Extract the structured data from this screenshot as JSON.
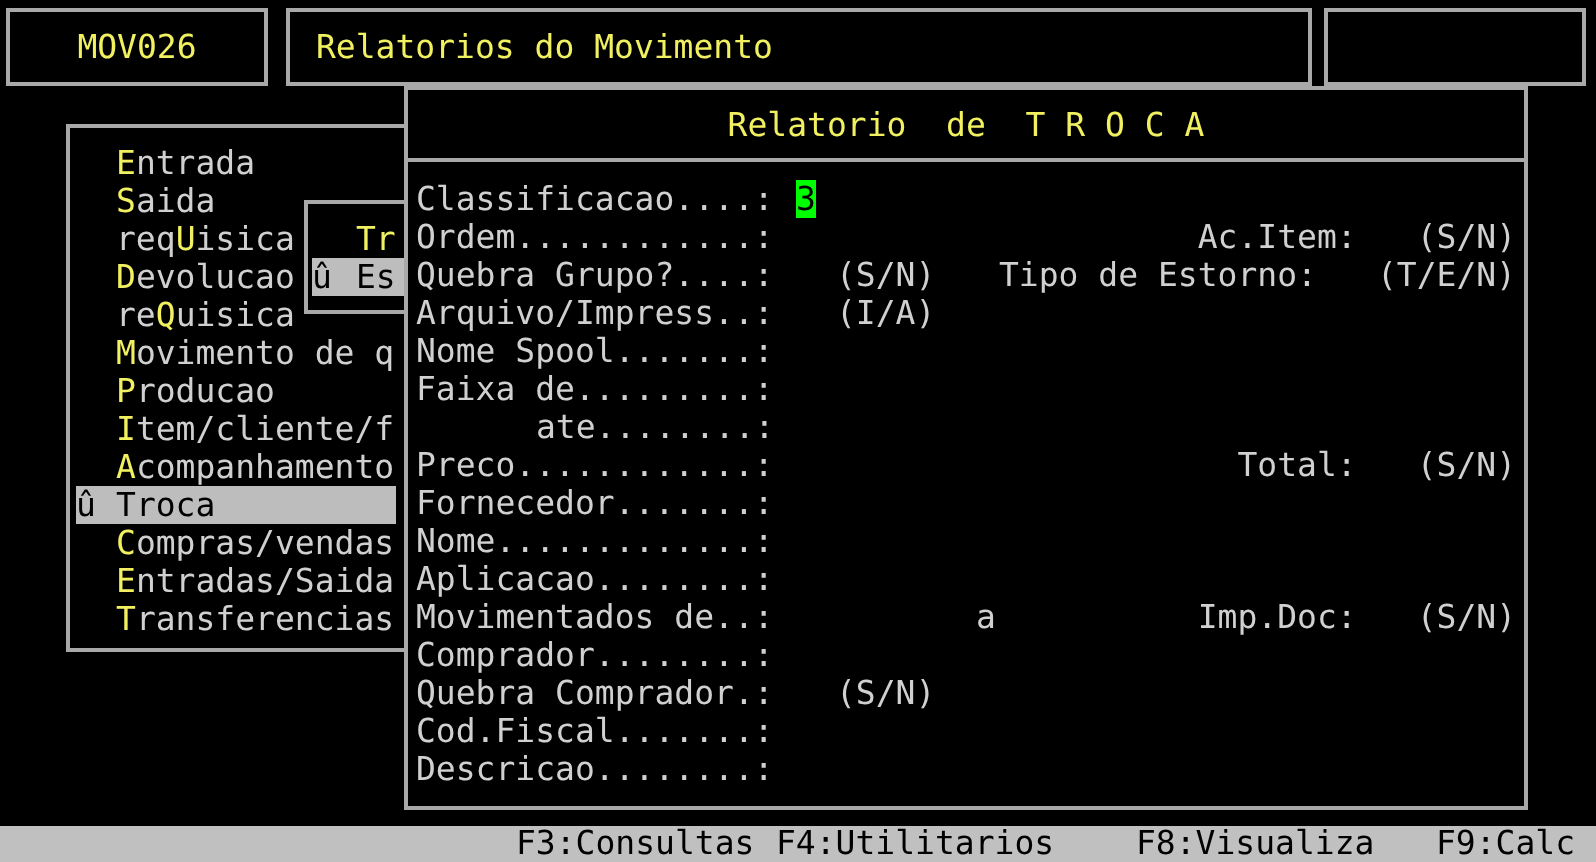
{
  "header": {
    "code": "MOV026",
    "title": "Relatorios do Movimento"
  },
  "menu": {
    "items": [
      {
        "key": "E",
        "after": "ntrada",
        "selected": false
      },
      {
        "key": "S",
        "after": "aida",
        "selected": false
      },
      {
        "before": "req",
        "key": "U",
        "after": "isica",
        "selected": false
      },
      {
        "key": "D",
        "after": "evolucao",
        "selected": false
      },
      {
        "before": "re",
        "key": "Q",
        "after": "uisica",
        "selected": false
      },
      {
        "key": "M",
        "after": "ovimento de q",
        "selected": false
      },
      {
        "key": "P",
        "after": "roducao",
        "selected": false
      },
      {
        "key": "I",
        "after": "tem/cliente/f",
        "selected": false
      },
      {
        "key": "A",
        "after": "companhamento",
        "selected": false
      },
      {
        "marker": "û",
        "key": "T",
        "after": "roca",
        "selected": true
      },
      {
        "key": "C",
        "after": "ompras/vendas",
        "selected": false
      },
      {
        "key": "E",
        "after": "ntradas/Saida",
        "selected": false
      },
      {
        "key": "T",
        "after": "ransferencias",
        "selected": false
      }
    ]
  },
  "submenu": {
    "items": [
      {
        "text": "Tr",
        "selected": false
      },
      {
        "marker": "û",
        "text": "Es",
        "selected": true
      }
    ]
  },
  "dialog": {
    "title": "Relatorio  de  T R O C A",
    "fields": [
      {
        "kind": "field",
        "label": "Classificacao....:",
        "value": "3",
        "focused": true
      },
      {
        "kind": "field",
        "label": "Ordem............:",
        "option_label": "Ac.Item:",
        "option_hint": "(S/N)"
      },
      {
        "kind": "field",
        "label": "Quebra Grupo?....:",
        "hint": "(S/N)",
        "option_label": "Tipo de Estorno:",
        "option_hint": "(T/E/N)"
      },
      {
        "kind": "field",
        "label": "Arquivo/Impress..:",
        "hint": "(I/A)"
      },
      {
        "kind": "field",
        "label": "Nome Spool.......:"
      },
      {
        "kind": "field",
        "label": "Faixa de.........:"
      },
      {
        "kind": "continuation",
        "label": "ate........:"
      },
      {
        "kind": "field",
        "label": "Preco............:",
        "option_label": "Total:",
        "option_hint": "(S/N)"
      },
      {
        "kind": "field",
        "label": "Fornecedor.......:"
      },
      {
        "kind": "field",
        "label": "Nome.............:"
      },
      {
        "kind": "field",
        "label": "Aplicacao........:"
      },
      {
        "kind": "field",
        "label": "Movimentados de..:",
        "range_to": "a",
        "option_label": "Imp.Doc:",
        "option_hint": "(S/N)"
      },
      {
        "kind": "field",
        "label": "Comprador........:"
      },
      {
        "kind": "field",
        "label": "Quebra Comprador.:",
        "hint": "(S/N)"
      },
      {
        "kind": "field",
        "label": "Cod.Fiscal.......:"
      },
      {
        "kind": "field",
        "label": "Descricao........:"
      }
    ]
  },
  "status_bar": [
    "F3:Consultas",
    "F4:Utilitarios",
    "F8:Visualiza",
    "F9:Calc"
  ]
}
